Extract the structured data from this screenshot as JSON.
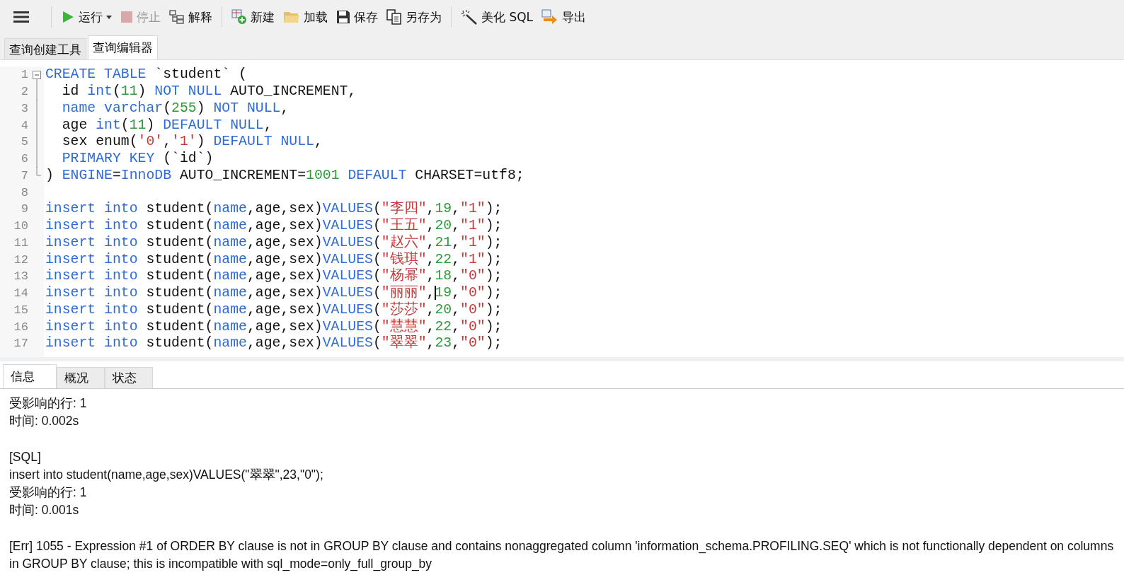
{
  "toolbar": [
    {
      "items": [
        {
          "kind": "menu"
        }
      ]
    },
    {
      "items": [
        {
          "kind": "run",
          "label": "运行",
          "dropdown": true,
          "disabled": false
        },
        {
          "kind": "stop",
          "label": "停止",
          "disabled": true
        },
        {
          "kind": "explain",
          "label": "解释",
          "disabled": false
        }
      ]
    },
    {
      "items": [
        {
          "kind": "new",
          "label": "新建",
          "disabled": false
        },
        {
          "kind": "load",
          "label": "加载",
          "disabled": false
        },
        {
          "kind": "save",
          "label": "保存",
          "disabled": false
        },
        {
          "kind": "save-as",
          "label": "另存为",
          "disabled": false
        }
      ]
    },
    {
      "items": [
        {
          "kind": "beautify",
          "label": "美化 SQL",
          "disabled": false
        },
        {
          "kind": "export",
          "label": "导出",
          "disabled": false
        }
      ]
    }
  ],
  "tabs": [
    {
      "label": "查询创建工具",
      "selected": false
    },
    {
      "label": "查询编辑器",
      "selected": true
    }
  ],
  "editor": {
    "lines": [
      {
        "number": "1",
        "kind": "fold-start",
        "tokens": [
          {
            "color": "#2f6bd6",
            "t": "CREATE TABLE"
          },
          {
            "color": "#111111",
            "t": " `student` ("
          }
        ]
      },
      {
        "number": "2",
        "kind": "fold-body",
        "tokens": [
          {
            "color": "#111111",
            "t": "  id "
          },
          {
            "color": "#2f6bd6",
            "t": "int"
          },
          {
            "color": "#111111",
            "t": "("
          },
          {
            "color": "#2e9b3a",
            "t": "11"
          },
          {
            "color": "#111111",
            "t": ") "
          },
          {
            "color": "#2f6bd6",
            "t": "NOT NULL"
          },
          {
            "color": "#111111",
            "t": " AUTO_INCREMENT,"
          }
        ]
      },
      {
        "number": "3",
        "kind": "fold-body",
        "tokens": [
          {
            "color": "#2f6bd6",
            "t": "  name varchar"
          },
          {
            "color": "#111111",
            "t": "("
          },
          {
            "color": "#2e9b3a",
            "t": "255"
          },
          {
            "color": "#111111",
            "t": ") "
          },
          {
            "color": "#2f6bd6",
            "t": "NOT NULL"
          },
          {
            "color": "#111111",
            "t": ","
          }
        ]
      },
      {
        "number": "4",
        "kind": "fold-body",
        "tokens": [
          {
            "color": "#111111",
            "t": "  age "
          },
          {
            "color": "#2f6bd6",
            "t": "int"
          },
          {
            "color": "#111111",
            "t": "("
          },
          {
            "color": "#2e9b3a",
            "t": "11"
          },
          {
            "color": "#111111",
            "t": ") "
          },
          {
            "color": "#2f6bd6",
            "t": "DEFAULT NULL"
          },
          {
            "color": "#111111",
            "t": ","
          }
        ]
      },
      {
        "number": "5",
        "kind": "fold-body",
        "tokens": [
          {
            "color": "#111111",
            "t": "  sex enum("
          },
          {
            "color": "#c23b3b",
            "t": "'0'"
          },
          {
            "color": "#111111",
            "t": ","
          },
          {
            "color": "#c23b3b",
            "t": "'1'"
          },
          {
            "color": "#111111",
            "t": ") "
          },
          {
            "color": "#2f6bd6",
            "t": "DEFAULT NULL"
          },
          {
            "color": "#111111",
            "t": ","
          }
        ]
      },
      {
        "number": "6",
        "kind": "fold-body",
        "tokens": [
          {
            "color": "#2f6bd6",
            "t": "  PRIMARY KEY"
          },
          {
            "color": "#111111",
            "t": " (`id`)"
          }
        ]
      },
      {
        "number": "7",
        "kind": "fold-end",
        "tokens": [
          {
            "color": "#111111",
            "t": ") "
          },
          {
            "color": "#2f6bd6",
            "t": "ENGINE"
          },
          {
            "color": "#111111",
            "t": "="
          },
          {
            "color": "#2f6bd6",
            "t": "InnoDB"
          },
          {
            "color": "#111111",
            "t": " AUTO_INCREMENT="
          },
          {
            "color": "#2e9b3a",
            "t": "1001"
          },
          {
            "color": "#2f6bd6",
            "t": " DEFAULT"
          },
          {
            "color": "#111111",
            "t": " CHARSET=utf8;"
          }
        ]
      },
      {
        "number": "8",
        "kind": "plain"
      },
      {
        "number": "9",
        "kind": "plain",
        "tokens": [
          {
            "color": "#2f6bd6",
            "t": "insert into"
          },
          {
            "color": "#111111",
            "t": " student("
          },
          {
            "color": "#2f6bd6",
            "t": "name"
          },
          {
            "color": "#111111",
            "t": ",age,sex)"
          },
          {
            "color": "#2f6bd6",
            "t": "VALUES"
          },
          {
            "color": "#111111",
            "t": "("
          },
          {
            "color": "#c23b3b",
            "t": "\"李四\""
          },
          {
            "color": "#111111",
            "t": ","
          },
          {
            "color": "#2e9b3a",
            "t": "19"
          },
          {
            "color": "#111111",
            "t": ","
          },
          {
            "color": "#c23b3b",
            "t": "\"1\""
          },
          {
            "color": "#111111",
            "t": ");"
          }
        ]
      },
      {
        "number": "10",
        "kind": "plain",
        "tokens": [
          {
            "color": "#2f6bd6",
            "t": "insert into"
          },
          {
            "color": "#111111",
            "t": " student("
          },
          {
            "color": "#2f6bd6",
            "t": "name"
          },
          {
            "color": "#111111",
            "t": ",age,sex)"
          },
          {
            "color": "#2f6bd6",
            "t": "VALUES"
          },
          {
            "color": "#111111",
            "t": "("
          },
          {
            "color": "#c23b3b",
            "t": "\"王五\""
          },
          {
            "color": "#111111",
            "t": ","
          },
          {
            "color": "#2e9b3a",
            "t": "20"
          },
          {
            "color": "#111111",
            "t": ","
          },
          {
            "color": "#c23b3b",
            "t": "\"1\""
          },
          {
            "color": "#111111",
            "t": ");"
          }
        ]
      },
      {
        "number": "11",
        "kind": "plain",
        "tokens": [
          {
            "color": "#2f6bd6",
            "t": "insert into"
          },
          {
            "color": "#111111",
            "t": " student("
          },
          {
            "color": "#2f6bd6",
            "t": "name"
          },
          {
            "color": "#111111",
            "t": ",age,sex)"
          },
          {
            "color": "#2f6bd6",
            "t": "VALUES"
          },
          {
            "color": "#111111",
            "t": "("
          },
          {
            "color": "#c23b3b",
            "t": "\"赵六\""
          },
          {
            "color": "#111111",
            "t": ","
          },
          {
            "color": "#2e9b3a",
            "t": "21"
          },
          {
            "color": "#111111",
            "t": ","
          },
          {
            "color": "#c23b3b",
            "t": "\"1\""
          },
          {
            "color": "#111111",
            "t": ");"
          }
        ]
      },
      {
        "number": "12",
        "kind": "plain",
        "tokens": [
          {
            "color": "#2f6bd6",
            "t": "insert into"
          },
          {
            "color": "#111111",
            "t": " student("
          },
          {
            "color": "#2f6bd6",
            "t": "name"
          },
          {
            "color": "#111111",
            "t": ",age,sex)"
          },
          {
            "color": "#2f6bd6",
            "t": "VALUES"
          },
          {
            "color": "#111111",
            "t": "("
          },
          {
            "color": "#c23b3b",
            "t": "\"钱琪\""
          },
          {
            "color": "#111111",
            "t": ","
          },
          {
            "color": "#2e9b3a",
            "t": "22"
          },
          {
            "color": "#111111",
            "t": ","
          },
          {
            "color": "#c23b3b",
            "t": "\"1\""
          },
          {
            "color": "#111111",
            "t": ");"
          }
        ]
      },
      {
        "number": "13",
        "kind": "plain",
        "tokens": [
          {
            "color": "#2f6bd6",
            "t": "insert into"
          },
          {
            "color": "#111111",
            "t": " student("
          },
          {
            "color": "#2f6bd6",
            "t": "name"
          },
          {
            "color": "#111111",
            "t": ",age,sex)"
          },
          {
            "color": "#2f6bd6",
            "t": "VALUES"
          },
          {
            "color": "#111111",
            "t": "("
          },
          {
            "color": "#c23b3b",
            "t": "\"杨幂\""
          },
          {
            "color": "#111111",
            "t": ","
          },
          {
            "color": "#2e9b3a",
            "t": "18"
          },
          {
            "color": "#111111",
            "t": ","
          },
          {
            "color": "#c23b3b",
            "t": "\"0\""
          },
          {
            "color": "#111111",
            "t": ");"
          }
        ]
      },
      {
        "number": "14",
        "kind": "plain",
        "tokens": [
          {
            "color": "#2f6bd6",
            "t": "insert into"
          },
          {
            "color": "#111111",
            "t": " student("
          },
          {
            "color": "#2f6bd6",
            "t": "name"
          },
          {
            "color": "#111111",
            "t": ",age,sex)"
          },
          {
            "color": "#2f6bd6",
            "t": "VALUES"
          },
          {
            "color": "#111111",
            "t": "("
          },
          {
            "color": "#c23b3b",
            "t": "\"丽丽\""
          },
          {
            "color": "#111111",
            "t": ","
          },
          {
            "color": "#2e9b3a",
            "t": "19",
            "caret": true
          },
          {
            "color": "#111111",
            "t": ","
          },
          {
            "color": "#c23b3b",
            "t": "\"0\""
          },
          {
            "color": "#111111",
            "t": ");"
          }
        ]
      },
      {
        "number": "15",
        "kind": "plain",
        "tokens": [
          {
            "color": "#2f6bd6",
            "t": "insert into"
          },
          {
            "color": "#111111",
            "t": " student("
          },
          {
            "color": "#2f6bd6",
            "t": "name"
          },
          {
            "color": "#111111",
            "t": ",age,sex)"
          },
          {
            "color": "#2f6bd6",
            "t": "VALUES"
          },
          {
            "color": "#111111",
            "t": "("
          },
          {
            "color": "#c23b3b",
            "t": "\"莎莎\""
          },
          {
            "color": "#111111",
            "t": ","
          },
          {
            "color": "#2e9b3a",
            "t": "20"
          },
          {
            "color": "#111111",
            "t": ","
          },
          {
            "color": "#c23b3b",
            "t": "\"0\""
          },
          {
            "color": "#111111",
            "t": ");"
          }
        ]
      },
      {
        "number": "16",
        "kind": "plain",
        "tokens": [
          {
            "color": "#2f6bd6",
            "t": "insert into"
          },
          {
            "color": "#111111",
            "t": " student("
          },
          {
            "color": "#2f6bd6",
            "t": "name"
          },
          {
            "color": "#111111",
            "t": ",age,sex)"
          },
          {
            "color": "#2f6bd6",
            "t": "VALUES"
          },
          {
            "color": "#111111",
            "t": "("
          },
          {
            "color": "#c23b3b",
            "t": "\"慧慧\""
          },
          {
            "color": "#111111",
            "t": ","
          },
          {
            "color": "#2e9b3a",
            "t": "22"
          },
          {
            "color": "#111111",
            "t": ","
          },
          {
            "color": "#c23b3b",
            "t": "\"0\""
          },
          {
            "color": "#111111",
            "t": ");"
          }
        ]
      },
      {
        "number": "17",
        "kind": "plain",
        "tokens": [
          {
            "color": "#2f6bd6",
            "t": "insert into"
          },
          {
            "color": "#111111",
            "t": " student("
          },
          {
            "color": "#2f6bd6",
            "t": "name"
          },
          {
            "color": "#111111",
            "t": ",age,sex)"
          },
          {
            "color": "#2f6bd6",
            "t": "VALUES"
          },
          {
            "color": "#111111",
            "t": "("
          },
          {
            "color": "#c23b3b",
            "t": "\"翠翠\""
          },
          {
            "color": "#111111",
            "t": ","
          },
          {
            "color": "#2e9b3a",
            "t": "23"
          },
          {
            "color": "#111111",
            "t": ","
          },
          {
            "color": "#c23b3b",
            "t": "\"0\""
          },
          {
            "color": "#111111",
            "t": ");"
          }
        ]
      }
    ]
  },
  "result_tabs": [
    {
      "label": "信息",
      "selected": true
    },
    {
      "label": "概况",
      "selected": false
    },
    {
      "label": "状态",
      "selected": false
    }
  ],
  "messages": [
    {
      "lines": [
        "受影响的行: 1",
        "时间: 0.002s"
      ]
    },
    {
      "lines": [
        "[SQL]",
        "insert into student(name,age,sex)VALUES(\"翠翠\",23,\"0\");",
        "受影响的行: 1",
        "时间: 0.001s"
      ]
    },
    {
      "lines": [
        "[Err] 1055 - Expression #1 of ORDER BY clause is not in GROUP BY clause and contains nonaggregated column 'information_schema.PROFILING.SEQ' which is not functionally dependent on columns in GROUP BY clause; this is incompatible with sql_mode=only_full_group_by"
      ]
    }
  ]
}
